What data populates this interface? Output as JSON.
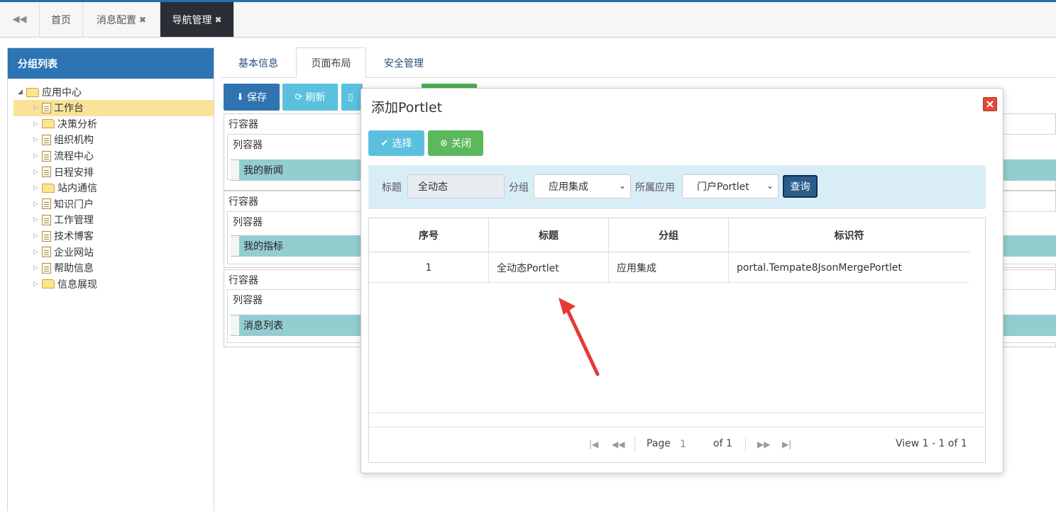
{
  "tabbar": {
    "back_icon": "double-left-arrow-icon",
    "tabs": [
      {
        "label": "首页",
        "closable": false
      },
      {
        "label": "消息配置",
        "closable": true
      },
      {
        "label": "导航管理",
        "closable": true,
        "active": true
      }
    ],
    "close_glyph": "✖"
  },
  "left_panel": {
    "title": "分组列表",
    "tree": {
      "root": "应用中心",
      "items": [
        {
          "label": "工作台",
          "icon": "doc-icon",
          "selected": true
        },
        {
          "label": "决策分析",
          "icon": "folder-icon"
        },
        {
          "label": "组织机构",
          "icon": "doc-icon"
        },
        {
          "label": "流程中心",
          "icon": "doc-icon"
        },
        {
          "label": "日程安排",
          "icon": "doc-icon"
        },
        {
          "label": "站内通信",
          "icon": "folder-icon"
        },
        {
          "label": "知识门户",
          "icon": "doc-icon"
        },
        {
          "label": "工作管理",
          "icon": "doc-icon"
        },
        {
          "label": "技术博客",
          "icon": "doc-icon"
        },
        {
          "label": "企业网站",
          "icon": "doc-icon"
        },
        {
          "label": "帮助信息",
          "icon": "doc-icon"
        },
        {
          "label": "信息展现",
          "icon": "folder-icon"
        }
      ]
    }
  },
  "subtabs": [
    {
      "label": "基本信息"
    },
    {
      "label": "页面布局",
      "active": true
    },
    {
      "label": "安全管理"
    }
  ],
  "toolbar": {
    "save_label": "保存",
    "refresh_label": "刷新"
  },
  "layout": {
    "row_label": "行容器",
    "col_label": "列容器",
    "portlets": [
      "我的新闻",
      "我的指标",
      "消息列表"
    ]
  },
  "dialog": {
    "title": "添加Portlet",
    "select_label": "选择",
    "close_label": "关闭",
    "search": {
      "title_label": "标题",
      "title_value": "全动态",
      "group_label": "分组",
      "group_value": "应用集成",
      "app_label": "所属应用",
      "app_value": "门户Portlet",
      "query_label": "查询"
    },
    "grid": {
      "columns": [
        "序号",
        "标题",
        "分组",
        "标识符"
      ],
      "rows": [
        {
          "no": "1",
          "title": "全动态Portlet",
          "group": "应用集成",
          "id": "portal.Tempate8JsonMergePortlet"
        }
      ]
    },
    "pager": {
      "page_label": "Page",
      "page_value": "1",
      "of_label": "of 1",
      "view_label": "View 1 - 1 of 1"
    }
  },
  "colors": {
    "primary": "#2c74b4",
    "info": "#5bc0de",
    "success": "#5cb85c",
    "selected": "#fbe29a",
    "portlet_bar": "#93cdd0",
    "annotation_arrow": "#e53935"
  }
}
